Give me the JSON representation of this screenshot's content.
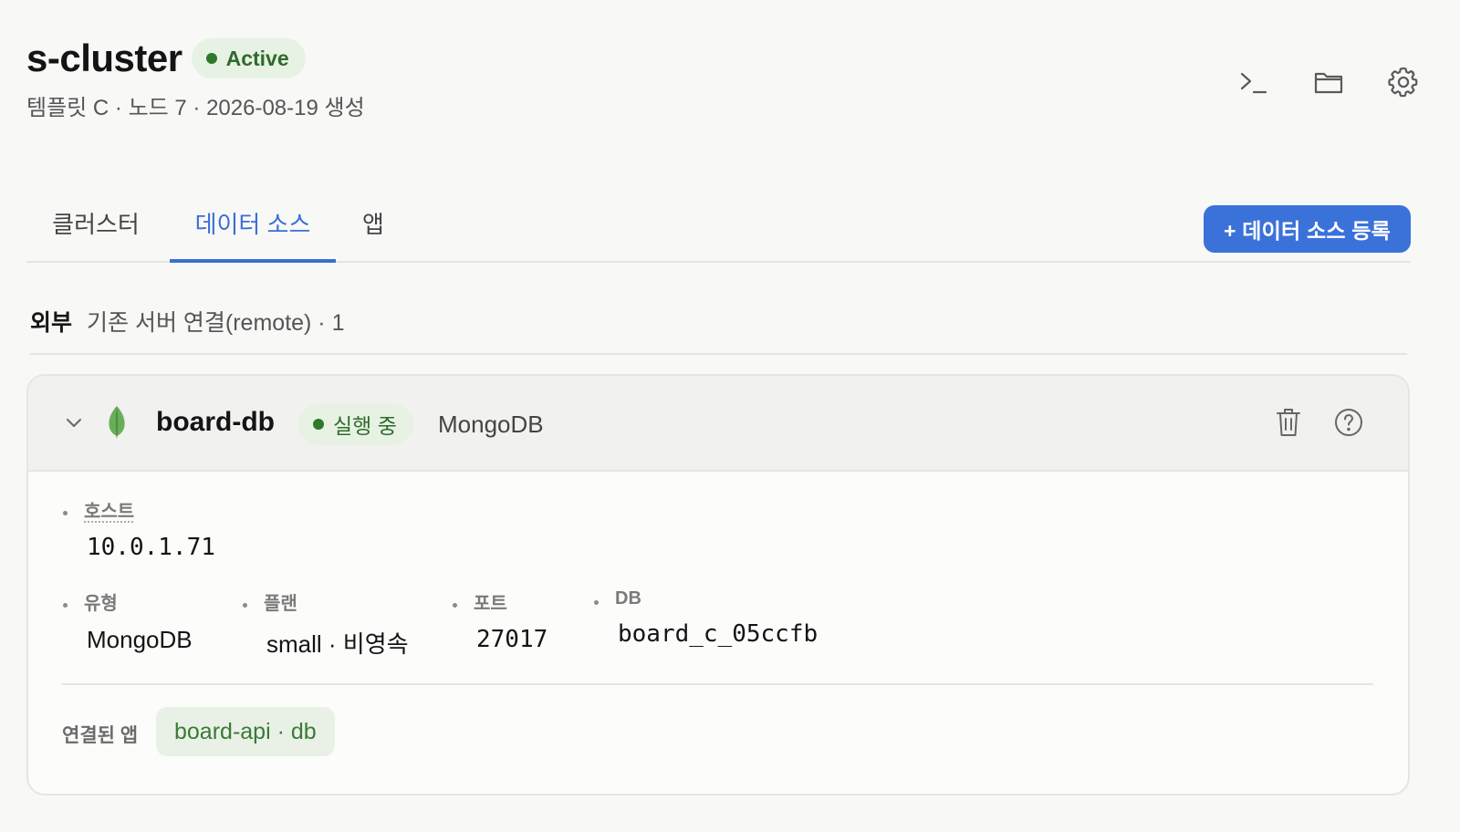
{
  "header": {
    "title": "s-cluster",
    "status": "Active",
    "subtitle": "템플릿 C · 노드 7 · 2026-08-19 생성",
    "icons": [
      "terminal-icon",
      "folder-icon",
      "gear-icon"
    ]
  },
  "tabs": [
    {
      "label": "클러스터",
      "active": false
    },
    {
      "label": "데이터 소스",
      "active": true
    },
    {
      "label": "앱",
      "active": false
    }
  ],
  "add_button": "+ 데이터 소스 등록",
  "section": {
    "key": "외부",
    "description": "기존 서버 연결(remote) · 1"
  },
  "datasource": {
    "name": "board-db",
    "status": "실행 중",
    "type_label": "MongoDB",
    "icon": "mongodb-leaf-icon",
    "fields": {
      "host": {
        "label": "호스트",
        "value": "10.0.1.71"
      },
      "type": {
        "label": "유형",
        "value": "MongoDB"
      },
      "plan": {
        "label": "플랜",
        "value": "small · 비영속"
      },
      "port": {
        "label": "포트",
        "value": "27017"
      },
      "db": {
        "label": "DB",
        "value": "board_c_05ccfb"
      }
    },
    "linked_label": "연결된 앱",
    "linked_apps": [
      "board-api · db"
    ]
  },
  "colors": {
    "accent": "#3b72d9",
    "status_green": "#2e7a2b",
    "status_bg": "#e7f2e4"
  }
}
